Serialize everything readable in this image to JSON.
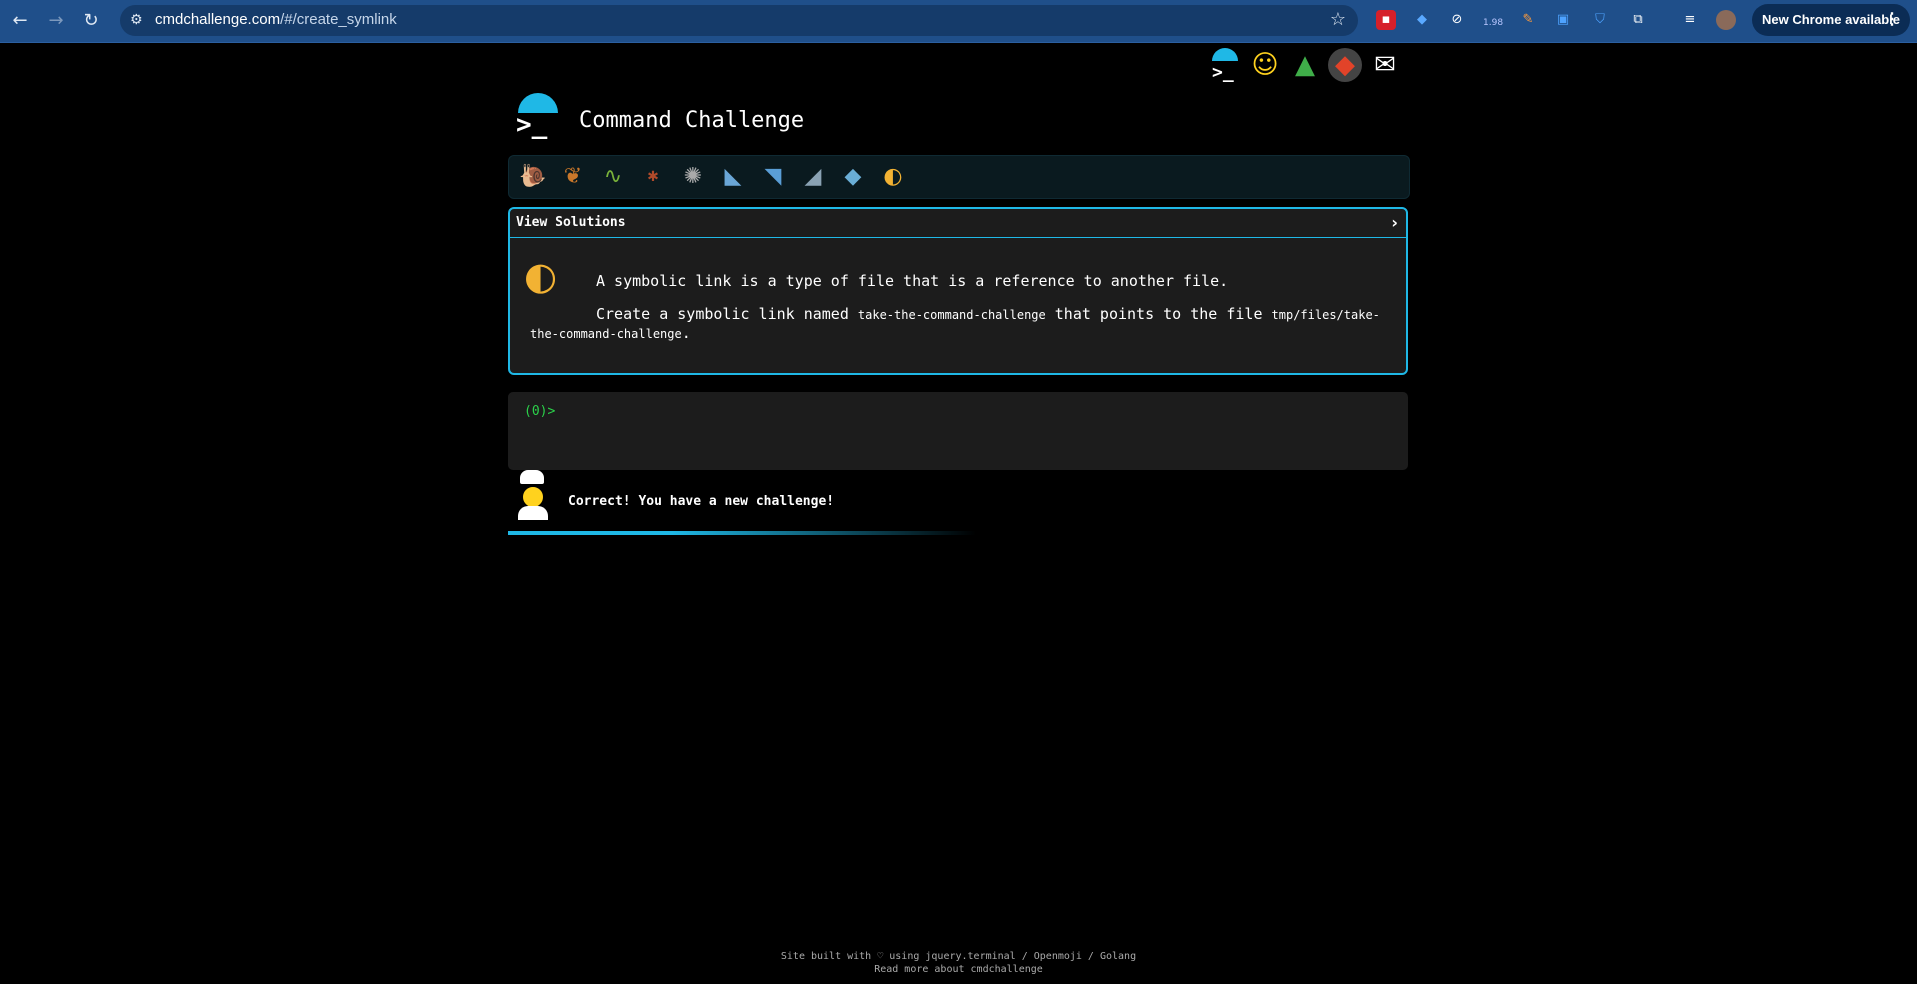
{
  "browser": {
    "url_host": "cmdchallenge.com",
    "url_path": "/#/create_symlink",
    "update_label": "New Chrome available",
    "menu_glyph": "⋮",
    "extension_badge": "1.98"
  },
  "header": {
    "title": "Command Challenge",
    "top_icons": [
      "terminal-icon",
      "shushing-face-icon",
      "tree-icon",
      "gitlab-icon",
      "mail-icon"
    ]
  },
  "levels": [
    "snail",
    "butterfly",
    "caterpillar",
    "ant",
    "web",
    "whale",
    "fish",
    "dolphin",
    "fish-blue",
    "tropical-fish"
  ],
  "challenge": {
    "view_solutions_label": "View Solutions",
    "chevron": "›",
    "description": "A symbolic link is a type of file that is a reference to another file.",
    "task_prefix": "Create a symbolic link named",
    "link_name": "take-the-command-challenge",
    "task_middle": "that points to the file",
    "target_path": "tmp/files/take-the-command-challenge",
    "task_suffix": "."
  },
  "terminal": {
    "prompt": "(0)>"
  },
  "status": {
    "message": "Correct! You have a new challenge!",
    "progress": 0.35
  },
  "footer": {
    "line1": "Site built with ♡ using jquery.terminal / Openmoji / Golang",
    "line2": "Read more about cmdchallenge"
  },
  "colors": {
    "accent": "#1fb8e6",
    "prompt_green": "#2bd14a",
    "chrome_bar": "#1f4f8a"
  }
}
